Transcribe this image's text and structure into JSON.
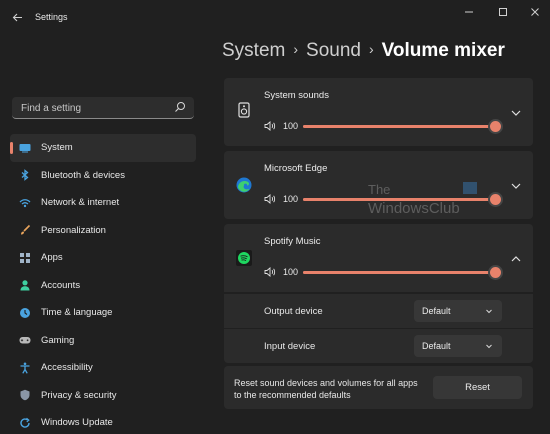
{
  "window": {
    "title": "Settings",
    "back_icon": "back-arrow-icon",
    "controls": [
      "minimize-icon",
      "maximize-icon",
      "close-icon"
    ]
  },
  "search": {
    "placeholder": "Find a setting",
    "value": "",
    "icon": "search-icon"
  },
  "sidebar": {
    "items": [
      {
        "label": "System",
        "icon": "system-icon",
        "active": true
      },
      {
        "label": "Bluetooth & devices",
        "icon": "bluetooth-icon"
      },
      {
        "label": "Network & internet",
        "icon": "wifi-icon"
      },
      {
        "label": "Personalization",
        "icon": "paintbrush-icon"
      },
      {
        "label": "Apps",
        "icon": "apps-icon"
      },
      {
        "label": "Accounts",
        "icon": "person-icon"
      },
      {
        "label": "Time & language",
        "icon": "globe-clock-icon"
      },
      {
        "label": "Gaming",
        "icon": "gamepad-icon"
      },
      {
        "label": "Accessibility",
        "icon": "accessibility-icon"
      },
      {
        "label": "Privacy & security",
        "icon": "shield-icon"
      },
      {
        "label": "Windows Update",
        "icon": "update-icon"
      }
    ]
  },
  "breadcrumb": {
    "parts": [
      "System",
      "Sound"
    ],
    "separator": "›",
    "current": "Volume mixer"
  },
  "apps": [
    {
      "name": "System sounds",
      "icon": "speaker-device-icon",
      "volume_label": "100",
      "volume": 100,
      "expanded": false
    },
    {
      "name": "Microsoft Edge",
      "icon": "edge-icon",
      "volume_label": "100",
      "volume": 100,
      "expanded": false
    },
    {
      "name": "Spotify Music",
      "icon": "spotify-icon",
      "volume_label": "100",
      "volume": 100,
      "expanded": true
    }
  ],
  "spotify_devices": {
    "output": {
      "label": "Output device",
      "value": "Default"
    },
    "input": {
      "label": "Input device",
      "value": "Default"
    }
  },
  "reset": {
    "description": "Reset sound devices and volumes for all apps to the recommended defaults",
    "button": "Reset"
  },
  "watermark": {
    "line1": "The",
    "line2": "WindowsClub"
  },
  "colors": {
    "accent": "#e8826b",
    "background": "#202020",
    "card": "#2b2b2b",
    "control": "#373737"
  }
}
